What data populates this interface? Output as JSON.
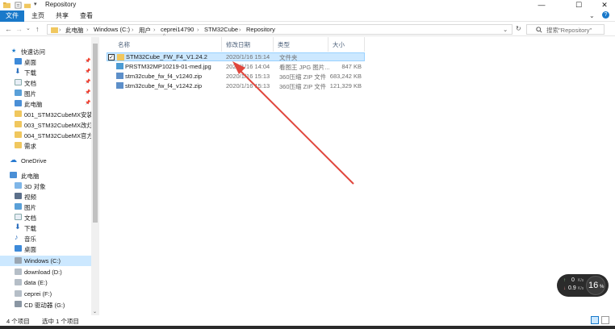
{
  "window": {
    "title": "Repository",
    "min": "—",
    "max": "☐",
    "close": "✕",
    "help": "?"
  },
  "ribbon": {
    "tabs": [
      "文件",
      "主页",
      "共享",
      "查看"
    ]
  },
  "address": {
    "back": "←",
    "forward": "→",
    "up": "↑",
    "crumbs": [
      "此电脑",
      "Windows (C:)",
      "用户",
      "ceprei14790",
      "STM32Cube",
      "Repository"
    ],
    "refresh": "↻",
    "search_placeholder": "搜索\"Repository\""
  },
  "nav": {
    "quick_access": "快速访问",
    "quick_items": [
      "桌面",
      "下载",
      "文档",
      "图片",
      "此电脑",
      "001_STM32CubeMX安装",
      "003_STM32CubeMX改灯",
      "004_STM32CubeMX官方例",
      "需求"
    ],
    "onedrive": "OneDrive",
    "this_pc": "此电脑",
    "pc_items": [
      "3D 对象",
      "视频",
      "图片",
      "文档",
      "下载",
      "音乐",
      "桌面",
      "Windows (C:)",
      "download (D:)",
      "data (E:)",
      "ceprei (F:)",
      "CD 驱动器 (G:)"
    ]
  },
  "columns": {
    "name": "名称",
    "date": "修改日期",
    "type": "类型",
    "size": "大小"
  },
  "files": [
    {
      "name": "STM32Cube_FW_F4_V1.24.2",
      "date": "2020/1/16 15:14",
      "type": "文件夹",
      "size": ""
    },
    {
      "name": "PRSTM32MP10219-01-med.jpg",
      "date": "2020/1/16 14:04",
      "type": "看图王 JPG 图片...",
      "size": "847 KB"
    },
    {
      "name": "stm32cube_fw_f4_v1240.zip",
      "date": "2020/1/16 15:13",
      "type": "360压缩 ZIP 文件",
      "size": "683,242 KB"
    },
    {
      "name": "stm32cube_fw_f4_v1242.zip",
      "date": "2020/1/16 15:13",
      "type": "360压缩 ZIP 文件",
      "size": "121,329 KB"
    }
  ],
  "status": {
    "items": "4 个项目",
    "selected": "选中 1 个项目"
  },
  "net_widget": {
    "up": "0",
    "up_unit": "K/s",
    "down": "0.9",
    "down_unit": "K/s",
    "percent": "16",
    "percent_unit": "%"
  },
  "colors": {
    "accent": "#1979ca",
    "selection": "#cce8ff",
    "arrow": "#e0463c"
  }
}
